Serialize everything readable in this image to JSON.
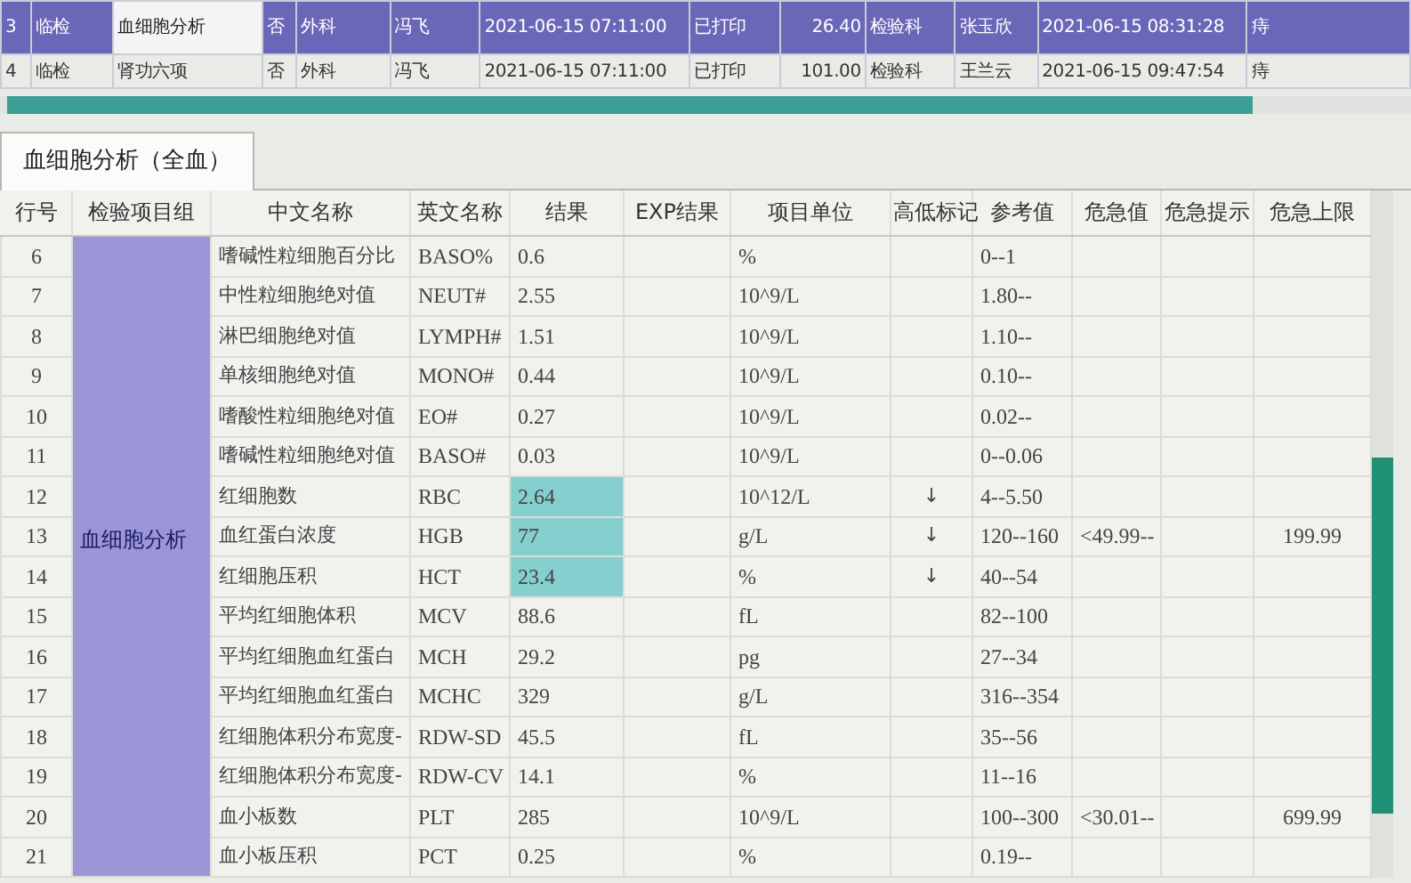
{
  "top_grid": {
    "rows": [
      {
        "selected": true,
        "cells": [
          "3",
          "临检",
          "血细胞分析",
          "否",
          "外科",
          "冯飞",
          "2021-06-15 07:11:00",
          "已打印",
          "26.40",
          "检验科",
          "张玉欣",
          "2021-06-15 08:31:28",
          "痔"
        ]
      },
      {
        "selected": false,
        "cells": [
          "4",
          "临检",
          "肾功六项",
          "否",
          "外科",
          "冯飞",
          "2021-06-15 07:11:00",
          "已打印",
          "101.00",
          "检验科",
          "王兰云",
          "2021-06-15 09:47:54",
          "痔"
        ]
      }
    ]
  },
  "tabs": [
    {
      "label": "血细胞分析（全血）",
      "selected": true
    }
  ],
  "results": {
    "columns": [
      "行号",
      "检验项目组",
      "中文名称",
      "英文名称",
      "结果",
      "EXP结果",
      "项目单位",
      "高低标记",
      "参考值",
      "危急值",
      "危急提示",
      "危急上限"
    ],
    "group": "血细胞分析",
    "rows": [
      {
        "no": "6",
        "cn": "嗜碱性粒细胞百分比",
        "en": "BASO%",
        "result": "0.6",
        "abnormal": false,
        "unit": "%",
        "flag": "",
        "ref": "0--1",
        "crit": "",
        "upper": ""
      },
      {
        "no": "7",
        "cn": "中性粒细胞绝对值",
        "en": "NEUT#",
        "result": "2.55",
        "abnormal": false,
        "unit": "10^9/L",
        "flag": "",
        "ref": "1.80--",
        "crit": "",
        "upper": ""
      },
      {
        "no": "8",
        "cn": "淋巴细胞绝对值",
        "en": "LYMPH#",
        "result": "1.51",
        "abnormal": false,
        "unit": "10^9/L",
        "flag": "",
        "ref": "1.10--",
        "crit": "",
        "upper": ""
      },
      {
        "no": "9",
        "cn": "单核细胞绝对值",
        "en": "MONO#",
        "result": "0.44",
        "abnormal": false,
        "unit": "10^9/L",
        "flag": "",
        "ref": "0.10--",
        "crit": "",
        "upper": ""
      },
      {
        "no": "10",
        "cn": "嗜酸性粒细胞绝对值",
        "en": "EO#",
        "result": "0.27",
        "abnormal": false,
        "unit": "10^9/L",
        "flag": "",
        "ref": "0.02--",
        "crit": "",
        "upper": ""
      },
      {
        "no": "11",
        "cn": "嗜碱性粒细胞绝对值",
        "en": "BASO#",
        "result": "0.03",
        "abnormal": false,
        "unit": "10^9/L",
        "flag": "",
        "ref": "0--0.06",
        "crit": "",
        "upper": ""
      },
      {
        "no": "12",
        "cn": "红细胞数",
        "en": "RBC",
        "result": "2.64",
        "abnormal": true,
        "unit": "10^12/L",
        "flag": "↓",
        "ref": "4--5.50",
        "crit": "",
        "upper": ""
      },
      {
        "no": "13",
        "cn": "血红蛋白浓度",
        "en": "HGB",
        "result": "77",
        "abnormal": true,
        "unit": "g/L",
        "flag": "↓",
        "ref": "120--160",
        "crit": "<49.99--",
        "upper": "199.99"
      },
      {
        "no": "14",
        "cn": "红细胞压积",
        "en": "HCT",
        "result": "23.4",
        "abnormal": true,
        "unit": "%",
        "flag": "↓",
        "ref": "40--54",
        "crit": "",
        "upper": ""
      },
      {
        "no": "15",
        "cn": "平均红细胞体积",
        "en": "MCV",
        "result": "88.6",
        "abnormal": false,
        "unit": "fL",
        "flag": "",
        "ref": "82--100",
        "crit": "",
        "upper": ""
      },
      {
        "no": "16",
        "cn": "平均红细胞血红蛋白",
        "en": "MCH",
        "result": "29.2",
        "abnormal": false,
        "unit": "pg",
        "flag": "",
        "ref": "27--34",
        "crit": "",
        "upper": ""
      },
      {
        "no": "17",
        "cn": "平均红细胞血红蛋白",
        "en": "MCHC",
        "result": "329",
        "abnormal": false,
        "unit": "g/L",
        "flag": "",
        "ref": "316--354",
        "crit": "",
        "upper": ""
      },
      {
        "no": "18",
        "cn": "红细胞体积分布宽度-",
        "en": "RDW-SD",
        "result": "45.5",
        "abnormal": false,
        "unit": "fL",
        "flag": "",
        "ref": "35--56",
        "crit": "",
        "upper": ""
      },
      {
        "no": "19",
        "cn": "红细胞体积分布宽度-",
        "en": "RDW-CV",
        "result": "14.1",
        "abnormal": false,
        "unit": "%",
        "flag": "",
        "ref": "11--16",
        "crit": "",
        "upper": ""
      },
      {
        "no": "20",
        "cn": "血小板数",
        "en": "PLT",
        "result": "285",
        "abnormal": false,
        "unit": "10^9/L",
        "flag": "",
        "ref": "100--300",
        "crit": "<30.01--",
        "upper": "699.99"
      },
      {
        "no": "21",
        "cn": "血小板压积",
        "en": "PCT",
        "result": "0.25",
        "abnormal": false,
        "unit": "%",
        "flag": "",
        "ref": "0.19--",
        "crit": "",
        "upper": ""
      }
    ]
  }
}
